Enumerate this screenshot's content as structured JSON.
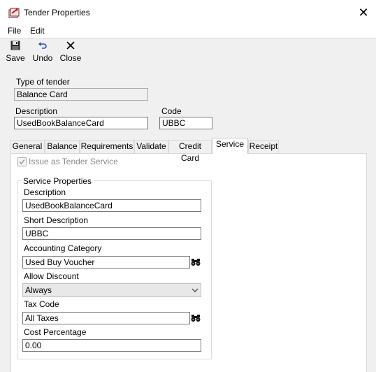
{
  "window": {
    "title": "Tender Properties"
  },
  "menu": {
    "file": "File",
    "edit": "Edit"
  },
  "toolbar": {
    "save": "Save",
    "undo": "Undo",
    "close": "Close"
  },
  "form": {
    "type_label": "Type of tender",
    "type_value": "Balance Card",
    "description_label": "Description",
    "description_value": "UsedBookBalanceCard",
    "code_label": "Code",
    "code_value": "UBBC"
  },
  "tabs": [
    "General",
    "Balance",
    "Requirements",
    "Validate",
    "Credit Card",
    "Service",
    "Receipt"
  ],
  "active_tab": "Service",
  "service": {
    "issue_checkbox_label": "Issue as Tender Service",
    "issue_checked": true,
    "group_title": "Service Properties",
    "description_label": "Description",
    "description_value": "UsedBookBalanceCard",
    "short_description_label": "Short Description",
    "short_description_value": "UBBC",
    "accounting_category_label": "Accounting Category",
    "accounting_category_value": "Used Buy Voucher",
    "allow_discount_label": "Allow Discount",
    "allow_discount_value": "Always",
    "tax_code_label": "Tax Code",
    "tax_code_value": "All Taxes",
    "cost_percentage_label": "Cost Percentage",
    "cost_percentage_value": "0.00"
  },
  "icons": {
    "app": "tender-properties-icon",
    "save": "floppy-disk-icon",
    "undo": "undo-arrow-icon",
    "close": "close-x-icon",
    "lookup": "binoculars-icon",
    "dropdown": "chevron-down-icon"
  }
}
